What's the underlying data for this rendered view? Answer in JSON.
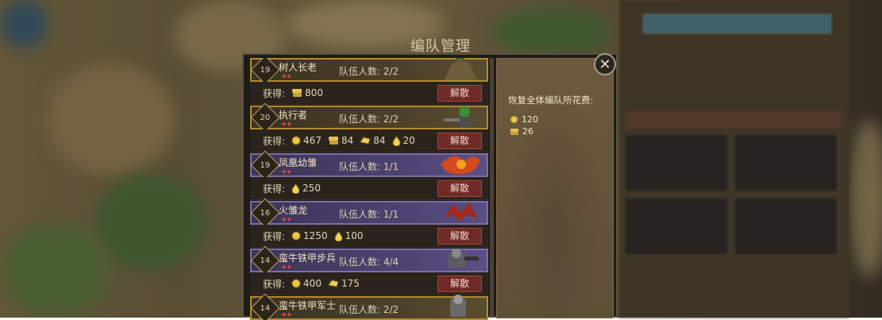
{
  "dialog": {
    "title": "编队管理",
    "disband_label": "解散",
    "get_label": "获得:",
    "team_label": "队伍人数:"
  },
  "units": [
    {
      "level": "19",
      "name": "树人长老",
      "team_count": "2/2",
      "style": "gold",
      "rewards": [
        {
          "icon": "wood-icon",
          "value": "800"
        }
      ]
    },
    {
      "level": "20",
      "name": "执行者",
      "team_count": "2/2",
      "style": "gold",
      "rewards": [
        {
          "icon": "gold-coin-icon",
          "value": "467"
        },
        {
          "icon": "wood-icon",
          "value": "84"
        },
        {
          "icon": "ore-icon",
          "value": "84"
        },
        {
          "icon": "gem-icon",
          "value": "20"
        }
      ]
    },
    {
      "level": "19",
      "name": "凤凰幼雏",
      "team_count": "1/1",
      "style": "purple",
      "rewards": [
        {
          "icon": "gem-icon",
          "value": "250"
        }
      ]
    },
    {
      "level": "16",
      "name": "火雏龙",
      "team_count": "1/1",
      "style": "purple",
      "rewards": [
        {
          "icon": "gold-coin-icon",
          "value": "1250"
        },
        {
          "icon": "gem-icon",
          "value": "100"
        }
      ]
    },
    {
      "level": "14",
      "name": "蛮牛铁甲步兵",
      "team_count": "4/4",
      "style": "purple",
      "rewards": [
        {
          "icon": "gold-coin-icon",
          "value": "400"
        },
        {
          "icon": "ore-icon",
          "value": "175"
        }
      ]
    },
    {
      "level": "14",
      "name": "蛮牛铁甲军士",
      "team_count": "2/2",
      "style": "gold",
      "rewards": []
    }
  ],
  "restore": {
    "title": "恢复全体编队所花费:",
    "costs": [
      {
        "icon": "gold-coin-icon",
        "value": "120"
      },
      {
        "icon": "wood-icon",
        "value": "26"
      }
    ]
  },
  "colors": {
    "gold_border": "#b48a33",
    "purple_border": "#7b6fa6",
    "disband_bg": "#6f2a26"
  }
}
